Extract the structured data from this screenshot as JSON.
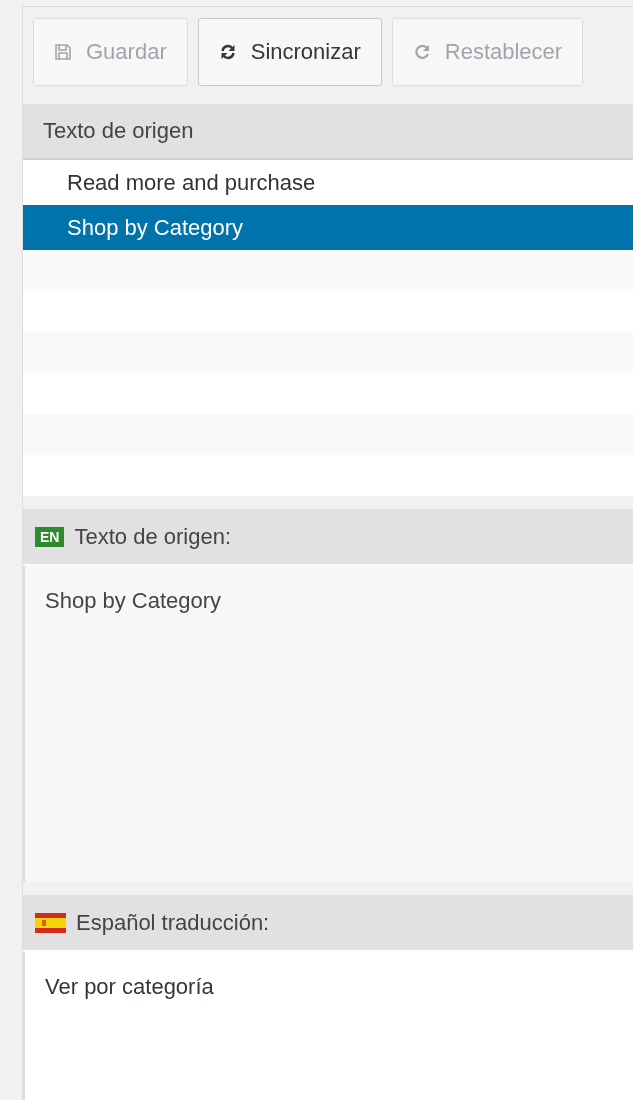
{
  "toolbar": [
    {
      "label": "Guardar",
      "kind": "save",
      "disabled": true
    },
    {
      "label": "Sincronizar",
      "kind": "sync",
      "disabled": false
    },
    {
      "label": "Restablecer",
      "kind": "reset",
      "disabled": true
    }
  ],
  "strings": {
    "header": "Texto de origen",
    "rows": [
      {
        "text": "Read more and purchase",
        "selected": false
      },
      {
        "text": "Shop by Category",
        "selected": true
      }
    ]
  },
  "source": {
    "badge": "EN",
    "label": "Texto de origen:",
    "text": "Shop by Category"
  },
  "translation": {
    "label": "Español traducción:",
    "value": "Ver por categoría"
  }
}
